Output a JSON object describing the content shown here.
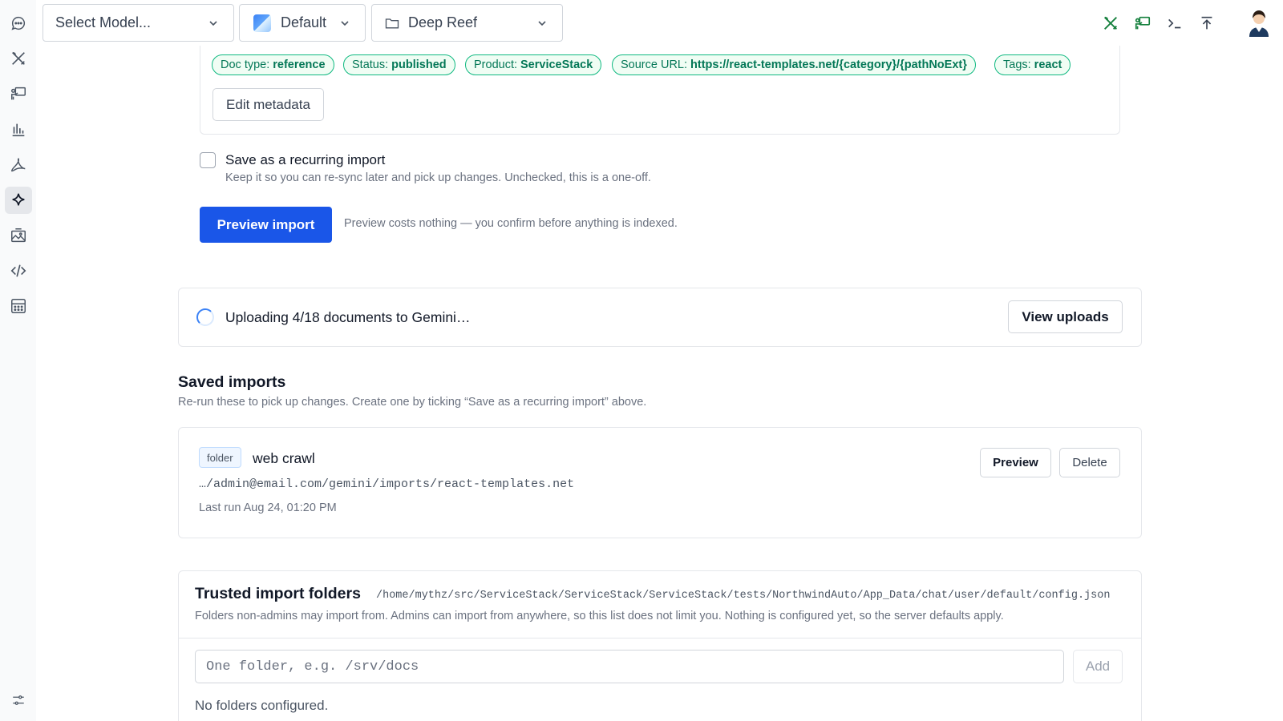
{
  "sidebar": {
    "items": [
      {
        "name": "chat-icon"
      },
      {
        "name": "tools-icon"
      },
      {
        "name": "presentation-icon"
      },
      {
        "name": "analytics-icon"
      },
      {
        "name": "pdf-icon"
      },
      {
        "name": "sparkle-icon",
        "active": true
      },
      {
        "name": "image-gallery-icon"
      },
      {
        "name": "code-icon"
      },
      {
        "name": "calculator-icon"
      }
    ],
    "bottom_icon": "settings-sliders-icon"
  },
  "topbar": {
    "model_select": "Select Model...",
    "profile_select": "Default",
    "folder_select": "Deep Reef",
    "right_icons": [
      "tools-icon",
      "presentation-icon",
      "terminal-icon",
      "upload-icon"
    ],
    "accent": "#15803d"
  },
  "metadata": {
    "chips": [
      {
        "key": "Doc type:",
        "value": "reference"
      },
      {
        "key": "Status:",
        "value": "published"
      },
      {
        "key": "Product:",
        "value": "ServiceStack"
      },
      {
        "key": "Source URL:",
        "value": "https://react-templates.net/{category}/{pathNoExt}"
      },
      {
        "key": "Tags:",
        "value": "react"
      }
    ],
    "edit_button": "Edit metadata"
  },
  "recurring": {
    "label": "Save as a recurring import",
    "help": "Keep it so you can re-sync later and pick up changes. Unchecked, this is a one-off.",
    "checked": false
  },
  "preview": {
    "button": "Preview import",
    "note": "Preview costs nothing — you confirm before anything is indexed."
  },
  "upload_status": {
    "text": "Uploading 4/18 documents to Gemini…",
    "button": "View uploads"
  },
  "saved_imports": {
    "title": "Saved imports",
    "subtitle": "Re-run these to pick up changes. Create one by ticking “Save as a recurring import” above.",
    "items": [
      {
        "badge": "folder",
        "name": "web crawl",
        "path": "…/admin@email.com/gemini/imports/react-templates.net",
        "last_run": "Last run Aug 24, 01:20 PM",
        "preview_button": "Preview",
        "delete_button": "Delete"
      }
    ]
  },
  "trusted": {
    "title": "Trusted import folders",
    "config_path": "/home/mythz/src/ServiceStack/ServiceStack/ServiceStack/tests/NorthwindAuto/App_Data/chat/user/default/config.json",
    "description": "Folders non-admins may import from. Admins can import from anywhere, so this list does not limit you. Nothing is configured yet, so the server defaults apply.",
    "input_placeholder": "One folder, e.g. /srv/docs",
    "add_button": "Add",
    "empty_text": "No folders configured."
  }
}
